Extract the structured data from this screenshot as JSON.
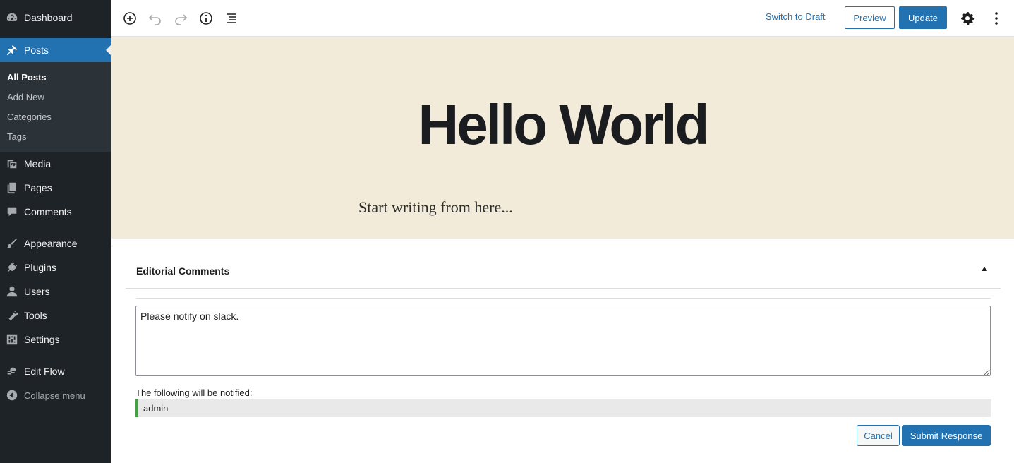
{
  "sidebar": {
    "items": [
      {
        "label": "Dashboard",
        "icon": "dashboard-icon"
      },
      {
        "label": "Posts",
        "icon": "pin-icon"
      },
      {
        "label": "Media",
        "icon": "media-icon"
      },
      {
        "label": "Pages",
        "icon": "pages-icon"
      },
      {
        "label": "Comments",
        "icon": "comments-icon"
      },
      {
        "label": "Appearance",
        "icon": "brush-icon"
      },
      {
        "label": "Plugins",
        "icon": "plug-icon"
      },
      {
        "label": "Users",
        "icon": "user-icon"
      },
      {
        "label": "Tools",
        "icon": "wrench-icon"
      },
      {
        "label": "Settings",
        "icon": "settings-sliders-icon"
      },
      {
        "label": "Edit Flow",
        "icon": "edit-flow-icon"
      }
    ],
    "submenu": [
      "All Posts",
      "Add New",
      "Categories",
      "Tags"
    ],
    "collapse_label": "Collapse menu",
    "accent_color": "#2271b1"
  },
  "toolbar": {
    "icons": [
      "add-block-icon",
      "undo-icon",
      "redo-icon",
      "info-icon",
      "list-view-icon",
      "settings-gear-icon",
      "more-options-icon"
    ],
    "switch_to_draft": "Switch to Draft",
    "preview": "Preview",
    "update": "Update"
  },
  "editor": {
    "title": "Hello World",
    "placeholder": "Start writing from here...",
    "background_color": "#f2ebda"
  },
  "editorial_comments": {
    "heading": "Editorial Comments",
    "comment_text": "Please notify on slack.",
    "notify_label": "The following will be notified:",
    "notified_users": [
      "admin"
    ],
    "cancel": "Cancel",
    "submit": "Submit Response"
  }
}
